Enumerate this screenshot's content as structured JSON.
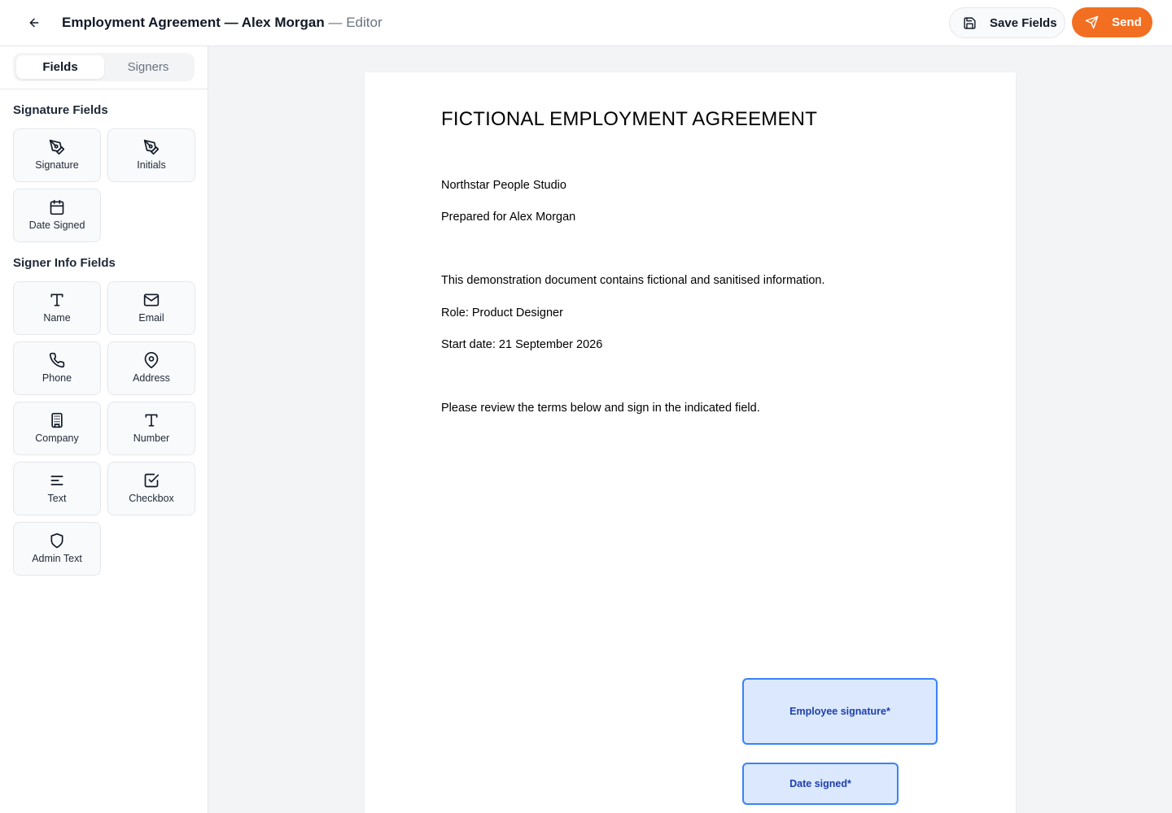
{
  "header": {
    "title": "Employment Agreement — Alex Morgan",
    "title_suffix": " — Editor",
    "save_label": "Save Fields",
    "send_label": "Send",
    "send_color": "#f26f21"
  },
  "sidebar": {
    "tabs": [
      {
        "label": "Fields",
        "active": true
      },
      {
        "label": "Signers",
        "active": false
      }
    ],
    "signature_section": {
      "title": "Signature Fields",
      "items": [
        {
          "label": "Signature",
          "icon": "pen-nib-icon"
        },
        {
          "label": "Initials",
          "icon": "pen-nib-icon"
        },
        {
          "label": "Date Signed",
          "icon": "calendar-icon"
        }
      ]
    },
    "signer_info_section": {
      "title": "Signer Info Fields",
      "items": [
        {
          "label": "Name",
          "icon": "text-t-icon"
        },
        {
          "label": "Email",
          "icon": "envelope-icon"
        },
        {
          "label": "Phone",
          "icon": "phone-icon"
        },
        {
          "label": "Address",
          "icon": "map-pin-icon"
        },
        {
          "label": "Company",
          "icon": "building-icon"
        },
        {
          "label": "Number",
          "icon": "text-t-icon"
        },
        {
          "label": "Text",
          "icon": "text-lines-icon"
        },
        {
          "label": "Checkbox",
          "icon": "checkbox-icon"
        },
        {
          "label": "Admin Text",
          "icon": "shield-icon"
        }
      ]
    }
  },
  "document": {
    "title": "FICTIONAL EMPLOYMENT AGREEMENT",
    "lines": [
      "Northstar People Studio",
      "Prepared for Alex Morgan",
      "This demonstration document contains fictional and sanitised information.",
      "Role: Product Designer",
      "Start date: 21 September 2026",
      "Please review the terms below and sign in the indicated field."
    ],
    "placed_fields": [
      {
        "label": "Employee signature*",
        "type": "signature"
      },
      {
        "label": "Date signed*",
        "type": "date"
      }
    ]
  }
}
